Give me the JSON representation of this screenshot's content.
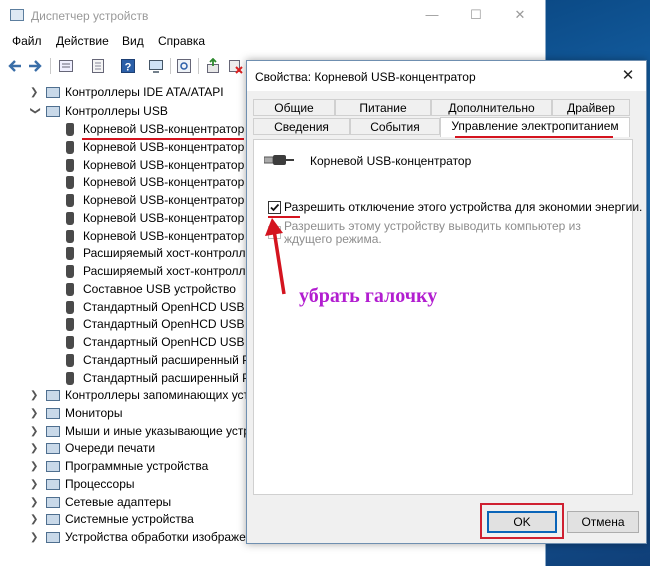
{
  "desktop": {
    "accent": "#1c6fb8"
  },
  "device_manager": {
    "title": "Диспетчер устройств",
    "menu": [
      "Файл",
      "Действие",
      "Вид",
      "Справка"
    ],
    "toolbar_icons": [
      "back-icon",
      "forward-icon",
      "properties-view-icon",
      "device-icon",
      "help-icon",
      "monitor-icon",
      "scan-icon",
      "update-driver-icon",
      "disable-device-icon"
    ],
    "tree": {
      "ide": "Контроллеры IDE ATA/ATAPI",
      "usb": "Контроллеры USB",
      "usb_children": [
        "Корневой USB-концентратор",
        "Корневой USB-концентратор",
        "Корневой USB-концентратор",
        "Корневой USB-концентратор",
        "Корневой USB-концентратор",
        "Корневой USB-концентратор",
        "Корневой USB-концентратор",
        "Расширяемый хост-контролл",
        "Расширяемый хост-контролл",
        "Составное USB устройство",
        "Стандартный OpenHCD USB хо",
        "Стандартный OpenHCD USB хо",
        "Стандартный OpenHCD USB хо",
        "Стандартный расширенный P",
        "Стандартный расширенный P"
      ],
      "after": [
        "Контроллеры запоминающих уст",
        "Мониторы",
        "Мыши и иные указывающие устр",
        "Очереди печати",
        "Программные устройства",
        "Процессоры",
        "Сетевые адаптеры",
        "Системные устройства",
        "Устройства обработки изображе"
      ]
    }
  },
  "dialog": {
    "title": "Свойства: Корневой USB-концентратор",
    "tabs_row1": [
      "Общие",
      "Питание",
      "Дополнительно",
      "Драйвер"
    ],
    "tabs_row2": [
      "Сведения",
      "События",
      "Управление электропитанием"
    ],
    "device_name": "Корневой USB-концентратор",
    "allow_off_label": "Разрешить отключение этого устройства для экономии энергии.",
    "allow_off_checked": true,
    "allow_wake_label": "Разрешить этому устройству выводить компьютер из ждущего режима.",
    "allow_wake_checked": false,
    "ok": "OK",
    "cancel": "Отмена"
  },
  "annotation": {
    "text": "убрать галочку",
    "color": "#b21dd0",
    "mark_color": "#d4141f"
  }
}
